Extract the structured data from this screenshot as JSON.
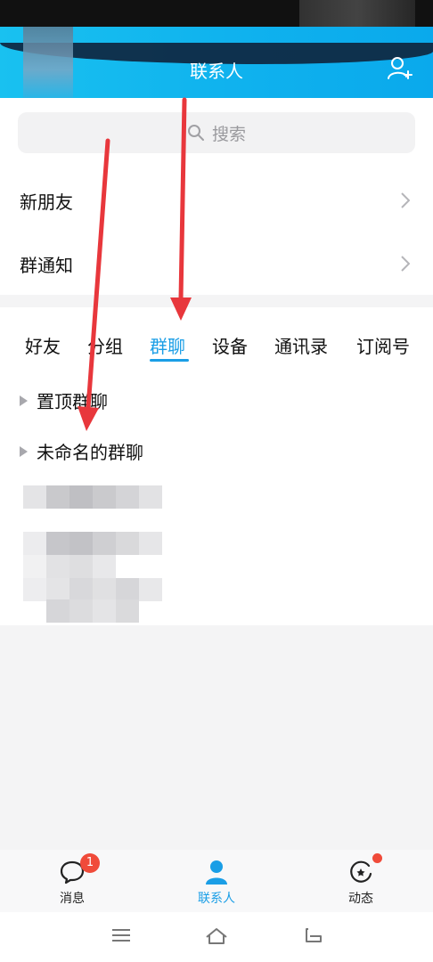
{
  "header": {
    "title": "联系人"
  },
  "search": {
    "placeholder": "搜索"
  },
  "rows": [
    {
      "label": "新朋友"
    },
    {
      "label": "群通知"
    }
  ],
  "tabs": [
    {
      "label": "好友"
    },
    {
      "label": "分组"
    },
    {
      "label": "群聊",
      "active": true
    },
    {
      "label": "设备"
    },
    {
      "label": "通讯录"
    },
    {
      "label": "订阅号"
    }
  ],
  "groups": [
    {
      "label": "置顶群聊"
    },
    {
      "label": "未命名的群聊"
    }
  ],
  "bottom_nav": {
    "items": [
      {
        "label": "消息",
        "icon": "chat-bubble-icon"
      },
      {
        "label": "联系人",
        "icon": "person-icon",
        "active": true
      },
      {
        "label": "动态",
        "icon": "star-circle-icon"
      }
    ],
    "messages_badge": "1"
  },
  "colors": {
    "accent": "#1a9ee6",
    "header": "#10b3ee",
    "annotation_arrow": "#e8373c",
    "badge": "#f04b3a"
  }
}
